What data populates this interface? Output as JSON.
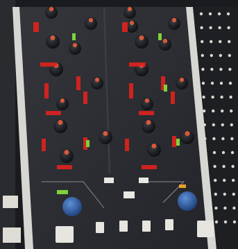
{
  "photo": {
    "subject": "",
    "colors": {
      "panel": "#2b2d31",
      "panel_dark": "#1a1b1e",
      "rail": "#cfd0cc",
      "knob": "#121316",
      "knob_cap": "#d65a3a",
      "led_red": "#e0221e",
      "led_green": "#7fd13a",
      "blue_knob": "#2f5fa8",
      "button": "#e3e2dc"
    }
  }
}
